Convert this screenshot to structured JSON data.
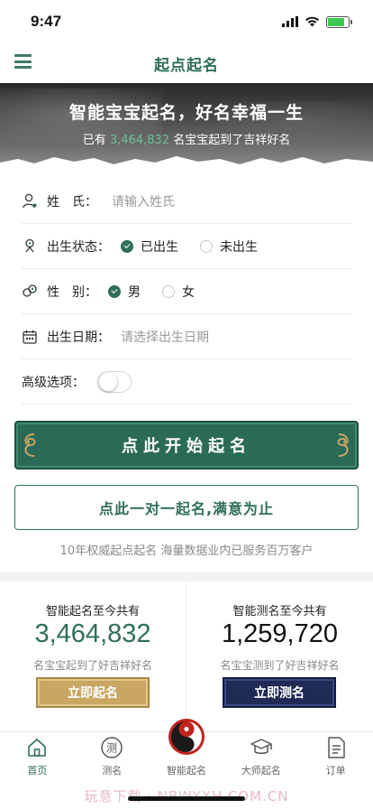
{
  "status_bar": {
    "time": "9:47",
    "icons": [
      "signal-icon",
      "wifi-icon",
      "battery-icon"
    ],
    "battery_level": 0.8
  },
  "nav": {
    "title": "起点起名",
    "menu_icon": "menu-icon"
  },
  "banner": {
    "title": "智能宝宝起名，好名幸福一生",
    "sub_prefix": "已有 ",
    "sub_number": "3,464,832",
    "sub_suffix": " 名宝宝起到了吉祥好名"
  },
  "form": {
    "surname": {
      "label": "姓　氏：",
      "placeholder": "请输入姓氏",
      "icon": "user-icon"
    },
    "birth_status": {
      "label": "出生状态：",
      "icon": "baby-icon",
      "options": [
        {
          "label": "已出生",
          "selected": true
        },
        {
          "label": "未出生",
          "selected": false
        }
      ]
    },
    "gender": {
      "label": "性　别：",
      "icon": "gender-icon",
      "options": [
        {
          "label": "男",
          "selected": true
        },
        {
          "label": "女",
          "selected": false
        }
      ]
    },
    "birth_date": {
      "label": "出生日期：",
      "placeholder": "请选择出生日期",
      "icon": "calendar-icon"
    },
    "advanced": {
      "label": "高级选项：",
      "enabled": false
    }
  },
  "buttons": {
    "start": "点此开始起名",
    "one_on_one": "点此一对一起名,满意为止"
  },
  "tagline": "10年权威起点起名 海量数据业内已服务百万客户",
  "stats": {
    "left": {
      "title": "智能起名至今共有",
      "number": "3,464,832",
      "sub": "名宝宝起到了好吉祥好名",
      "button": "立即起名"
    },
    "right": {
      "title": "智能测名至今共有",
      "number": "1,259,720",
      "sub": "名宝宝测到了好吉祥好名",
      "button": "立即测名"
    }
  },
  "tabs": [
    {
      "label": "首页",
      "icon": "home-icon",
      "active": true
    },
    {
      "label": "测名",
      "icon": "test-name-icon",
      "active": false
    },
    {
      "label": "智能起名",
      "icon": "yin-yang-icon",
      "active": false
    },
    {
      "label": "大师起名",
      "icon": "graduation-cap-icon",
      "active": false
    },
    {
      "label": "订单",
      "icon": "order-icon",
      "active": false
    }
  ],
  "watermark": "玩意下载 · NBWYXH.COM.CN",
  "colors": {
    "primary": "#2f6f5c",
    "gold": "#c8a763",
    "navy": "#1f2a55",
    "highlight": "#6cbf98"
  }
}
